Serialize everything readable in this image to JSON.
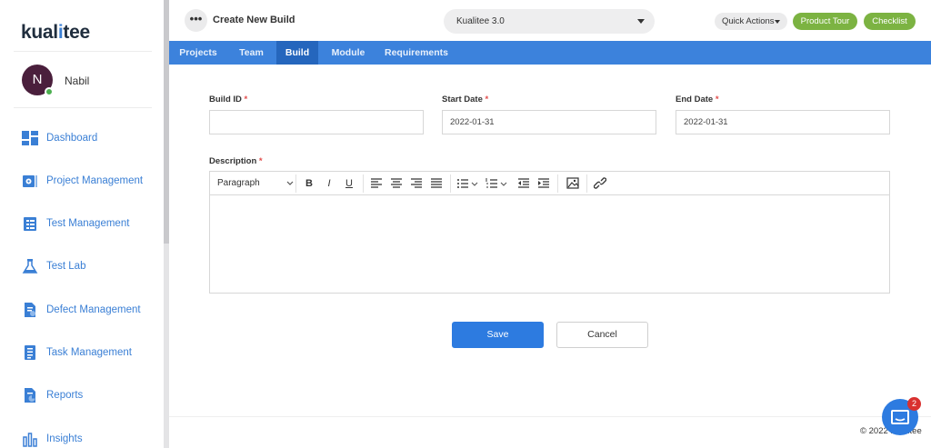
{
  "app": {
    "logo_pre": "kual",
    "logo_mid": "i",
    "logo_post": "tee"
  },
  "user": {
    "initial": "N",
    "name": "Nabil"
  },
  "sidebar": {
    "items": [
      {
        "label": "Dashboard",
        "icon": "dashboard-icon"
      },
      {
        "label": "Project Management",
        "icon": "project-management-icon"
      },
      {
        "label": "Test Management",
        "icon": "test-management-icon"
      },
      {
        "label": "Test Lab",
        "icon": "flask-icon"
      },
      {
        "label": "Defect Management",
        "icon": "defect-icon"
      },
      {
        "label": "Task Management",
        "icon": "task-icon"
      },
      {
        "label": "Reports",
        "icon": "reports-icon"
      },
      {
        "label": "Insights",
        "icon": "insights-icon"
      }
    ]
  },
  "header": {
    "menu_glyph": "•••",
    "title": "Create New Build",
    "project_selected": "Kualitee 3.0",
    "quick_actions": "Quick Actions",
    "product_tour": "Product Tour",
    "checklist": "Checklist"
  },
  "tabs": [
    {
      "label": "Projects"
    },
    {
      "label": "Team"
    },
    {
      "label": "Build",
      "active": true
    },
    {
      "label": "Module"
    },
    {
      "label": "Requirements"
    }
  ],
  "form": {
    "build_id": {
      "label": "Build ID",
      "value": ""
    },
    "start_date": {
      "label": "Start Date",
      "value": "2022-01-31"
    },
    "end_date": {
      "label": "End Date",
      "value": "2022-01-31"
    },
    "description": {
      "label": "Description",
      "block_format": "Paragraph"
    },
    "required_mark": "*"
  },
  "editor_toolbar": {
    "bold": "B",
    "italic": "I",
    "underline": "U"
  },
  "actions": {
    "save": "Save",
    "cancel": "Cancel"
  },
  "footer": {
    "copyright": "© 2022 Kualitee"
  },
  "chat": {
    "badge_count": "2"
  },
  "colors": {
    "primary": "#3c82dc",
    "active_tab": "#2566bd",
    "accent_green": "#7cb342",
    "required": "#e24c4b"
  }
}
